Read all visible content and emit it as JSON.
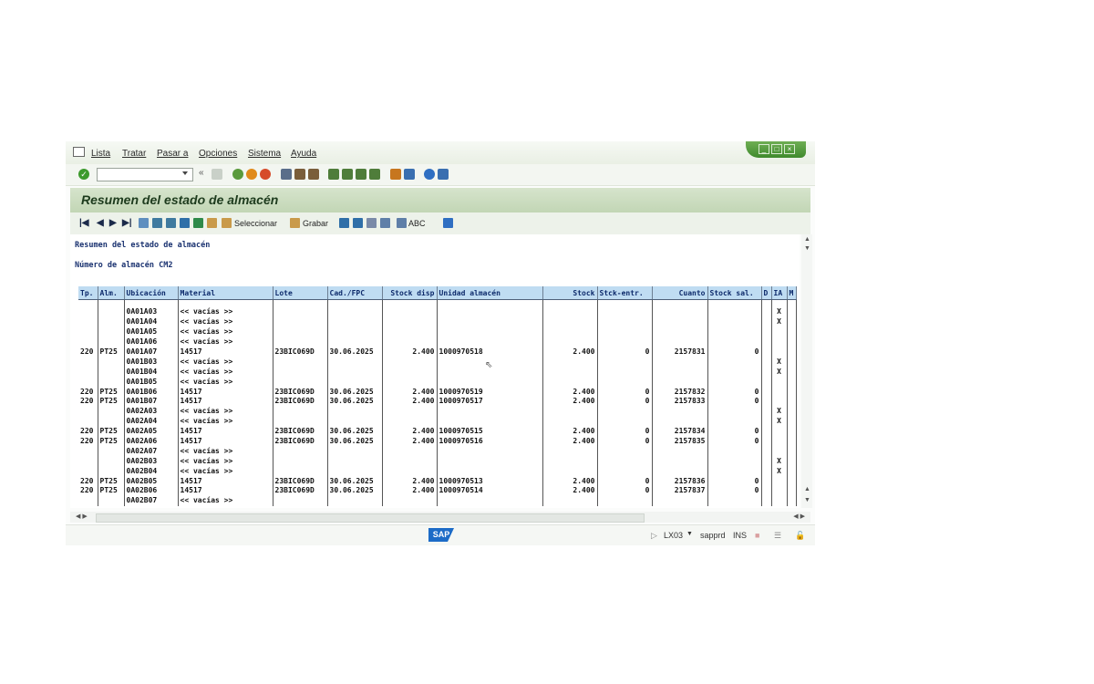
{
  "menu": {
    "items": [
      "Lista",
      "Tratar",
      "Pasar a",
      "Opciones",
      "Sistema",
      "Ayuda"
    ]
  },
  "std_toolbar": {
    "command_value": ""
  },
  "page": {
    "title": "Resumen del estado de almacén"
  },
  "app_toolbar": {
    "seleccionar_label": "Seleccionar",
    "grabar_label": "Grabar",
    "abc_label": "ABC"
  },
  "report": {
    "title": "Resumen del estado de almacén",
    "warehouse_line": "Número de almacén CM2"
  },
  "table": {
    "columns": [
      "Tp.",
      "Alm.",
      "Ubicación",
      "Material",
      "Lote",
      "Cad./FPC",
      "Stock disp",
      "Unidad almacén",
      "Stock",
      "Stck-entr.",
      "Cuanto",
      "Stock sal.",
      "D",
      "IA",
      "M"
    ],
    "rows": [
      [
        "",
        "",
        "0A01A03",
        "<< vacías >>",
        "",
        "",
        "",
        "",
        "",
        "",
        "",
        "",
        "",
        "X",
        ""
      ],
      [
        "",
        "",
        "0A01A04",
        "<< vacías >>",
        "",
        "",
        "",
        "",
        "",
        "",
        "",
        "",
        "",
        "X",
        ""
      ],
      [
        "",
        "",
        "0A01A05",
        "<< vacías >>",
        "",
        "",
        "",
        "",
        "",
        "",
        "",
        "",
        "",
        "",
        ""
      ],
      [
        "",
        "",
        "0A01A06",
        "<< vacías >>",
        "",
        "",
        "",
        "",
        "",
        "",
        "",
        "",
        "",
        "",
        ""
      ],
      [
        "220",
        "PT25",
        "0A01A07",
        "14517",
        "23BIC069D",
        "30.06.2025",
        "2.400",
        "1000970518",
        "2.400",
        "0",
        "2157831",
        "0",
        "",
        "",
        ""
      ],
      [
        "",
        "",
        "0A01B03",
        "<< vacías >>",
        "",
        "",
        "",
        "",
        "",
        "",
        "",
        "",
        "",
        "X",
        ""
      ],
      [
        "",
        "",
        "0A01B04",
        "<< vacías >>",
        "",
        "",
        "",
        "",
        "",
        "",
        "",
        "",
        "",
        "X",
        ""
      ],
      [
        "",
        "",
        "0A01B05",
        "<< vacías >>",
        "",
        "",
        "",
        "",
        "",
        "",
        "",
        "",
        "",
        "",
        ""
      ],
      [
        "220",
        "PT25",
        "0A01B06",
        "14517",
        "23BIC069D",
        "30.06.2025",
        "2.400",
        "1000970519",
        "2.400",
        "0",
        "2157832",
        "0",
        "",
        "",
        ""
      ],
      [
        "220",
        "PT25",
        "0A01B07",
        "14517",
        "23BIC069D",
        "30.06.2025",
        "2.400",
        "1000970517",
        "2.400",
        "0",
        "2157833",
        "0",
        "",
        "",
        ""
      ],
      [
        "",
        "",
        "0A02A03",
        "<< vacías >>",
        "",
        "",
        "",
        "",
        "",
        "",
        "",
        "",
        "",
        "X",
        ""
      ],
      [
        "",
        "",
        "0A02A04",
        "<< vacías >>",
        "",
        "",
        "",
        "",
        "",
        "",
        "",
        "",
        "",
        "X",
        ""
      ],
      [
        "220",
        "PT25",
        "0A02A05",
        "14517",
        "23BIC069D",
        "30.06.2025",
        "2.400",
        "1000970515",
        "2.400",
        "0",
        "2157834",
        "0",
        "",
        "",
        ""
      ],
      [
        "220",
        "PT25",
        "0A02A06",
        "14517",
        "23BIC069D",
        "30.06.2025",
        "2.400",
        "1000970516",
        "2.400",
        "0",
        "2157835",
        "0",
        "",
        "",
        ""
      ],
      [
        "",
        "",
        "0A02A07",
        "<< vacías >>",
        "",
        "",
        "",
        "",
        "",
        "",
        "",
        "",
        "",
        "",
        ""
      ],
      [
        "",
        "",
        "0A02B03",
        "<< vacías >>",
        "",
        "",
        "",
        "",
        "",
        "",
        "",
        "",
        "",
        "X",
        ""
      ],
      [
        "",
        "",
        "0A02B04",
        "<< vacías >>",
        "",
        "",
        "",
        "",
        "",
        "",
        "",
        "",
        "",
        "X",
        ""
      ],
      [
        "220",
        "PT25",
        "0A02B05",
        "14517",
        "23BIC069D",
        "30.06.2025",
        "2.400",
        "1000970513",
        "2.400",
        "0",
        "2157836",
        "0",
        "",
        "",
        ""
      ],
      [
        "220",
        "PT25",
        "0A02B06",
        "14517",
        "23BIC069D",
        "30.06.2025",
        "2.400",
        "1000970514",
        "2.400",
        "0",
        "2157837",
        "0",
        "",
        "",
        ""
      ],
      [
        "",
        "",
        "0A02B07",
        "<< vacías >>",
        "",
        "",
        "",
        "",
        "",
        "",
        "",
        "",
        "",
        "",
        ""
      ]
    ]
  },
  "status": {
    "transaction": "LX03",
    "server": "sapprd",
    "mode": "INS"
  },
  "colors": {
    "header_bg": "#bfdcf2",
    "title_bar": "#c8dabb",
    "window_controls": "#4f9a3b"
  }
}
